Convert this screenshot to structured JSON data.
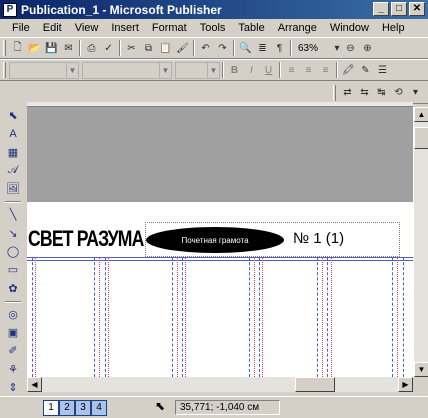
{
  "window": {
    "title": "Publication_1 - Microsoft Publisher",
    "app_icon": "P"
  },
  "menu": [
    "File",
    "Edit",
    "View",
    "Insert",
    "Format",
    "Tools",
    "Table",
    "Arrange",
    "Window",
    "Help"
  ],
  "standard_toolbar": {
    "zoom": "63%"
  },
  "document": {
    "masthead": "СВЕТ РАЗУМА",
    "oval_text": "Почетная грамота",
    "issue": "№ 1 (1)"
  },
  "status": {
    "pages": [
      "1",
      "2",
      "3",
      "4"
    ],
    "active_page": "1",
    "coords": "35,771; -1,040 см"
  },
  "colors": {
    "titlebar": "#0a246a",
    "guide": "#4060e0",
    "margin": "#e04060"
  }
}
